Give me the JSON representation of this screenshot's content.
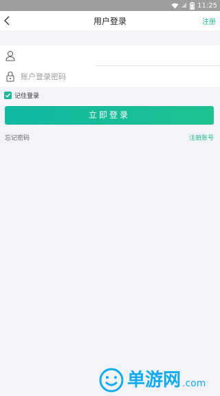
{
  "status_bar": {
    "time": "11:25"
  },
  "header": {
    "title": "用户登录",
    "register_link": "注册"
  },
  "form": {
    "username": {
      "value": "",
      "placeholder": ""
    },
    "password": {
      "value": "",
      "placeholder": "账户登录密码"
    }
  },
  "remember": {
    "label": "记住登录",
    "checked": true
  },
  "login_button": {
    "label": "立即登录"
  },
  "links": {
    "forgot": "忘记密码",
    "signup": "注册账号"
  },
  "watermark": {
    "text": "单游网",
    "suffix": ".com"
  },
  "colors": {
    "accent": "#1fb693",
    "watermark": "#11aaf0",
    "background": "#f3f4f8"
  }
}
